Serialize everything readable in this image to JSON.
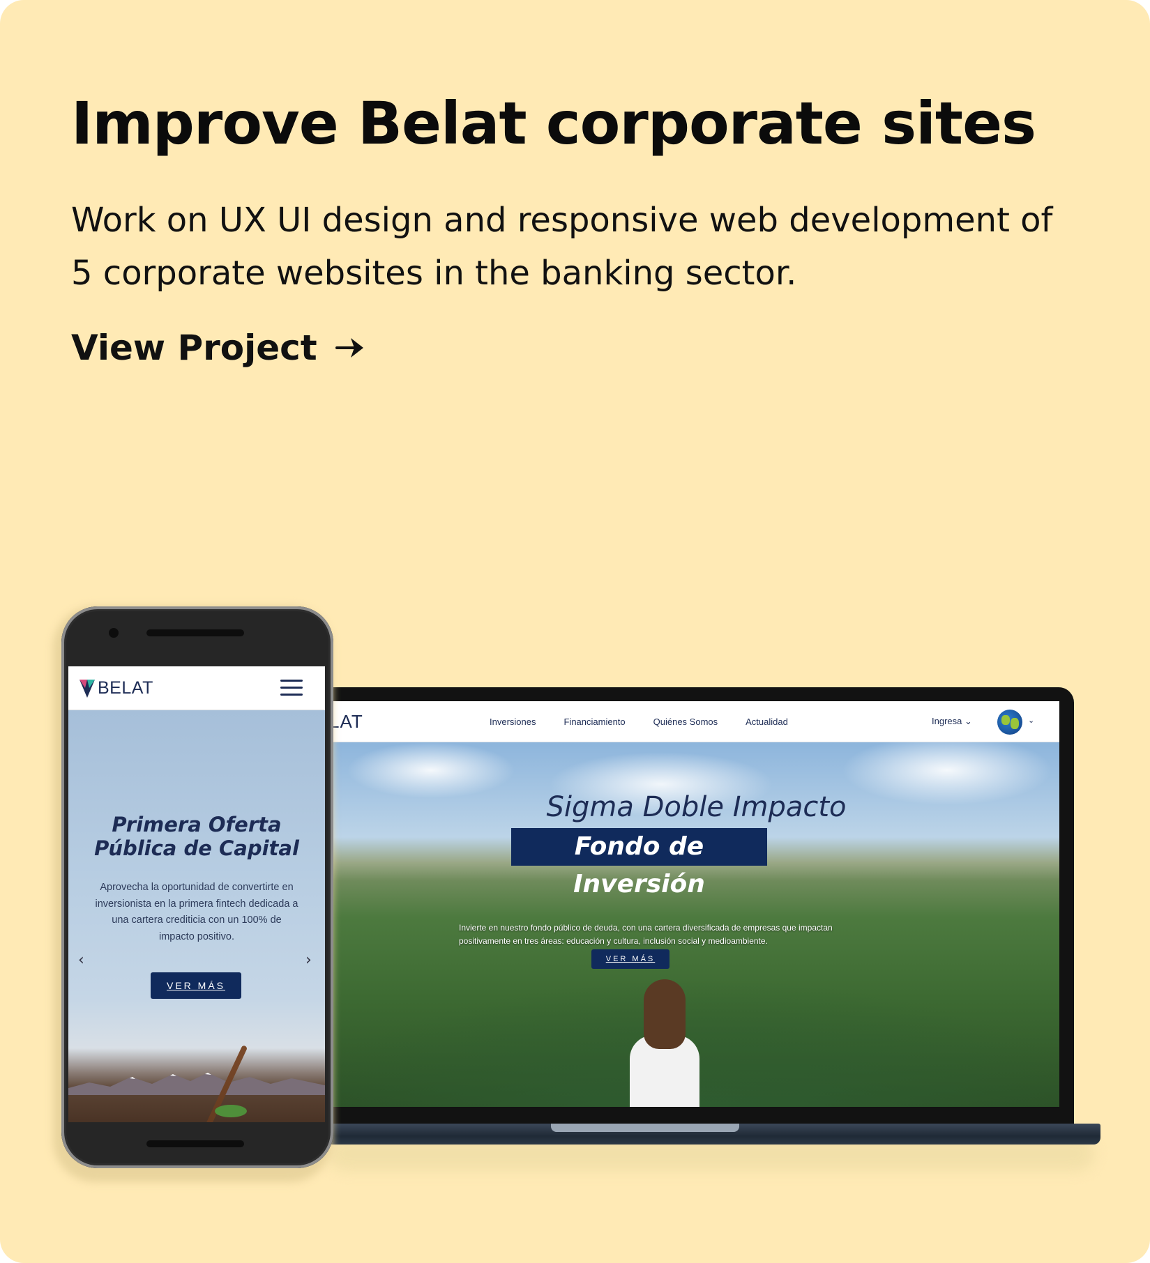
{
  "card": {
    "title": "Improve Belat corporate sites",
    "description": "Work on UX UI design and responsive web development of 5 corporate websites in the banking sector.",
    "cta_label": "View Project",
    "background": "#ffeab5"
  },
  "laptop_site": {
    "logo_text": "LAT",
    "nav": [
      "Inversiones",
      "Financiamiento",
      "Quiénes Somos",
      "Actualidad"
    ],
    "login_label": "Ingresa",
    "hero_title": "Sigma Doble Impacto",
    "hero_badge": "Fondo de Inversión",
    "hero_text": "Invierte en nuestro fondo público de deuda, con una cartera diversificada de empresas que impactan positivamente en tres áreas: educación y cultura, inclusión social y medioambiente.",
    "hero_button": "VER MÁS"
  },
  "phone_site": {
    "logo_text": "BELAT",
    "hero_title": "Primera Oferta Pública de Capital",
    "hero_text": "Aprovecha la oportunidad de convertirte en inversionista en la primera fintech dedicada a una cartera crediticia con un 100% de impacto positivo.",
    "hero_button": "VER MÁS",
    "prev_arrow": "‹",
    "next_arrow": "›"
  },
  "colors": {
    "brand_navy": "#102a5c",
    "text_dark": "#0b0b0b"
  }
}
